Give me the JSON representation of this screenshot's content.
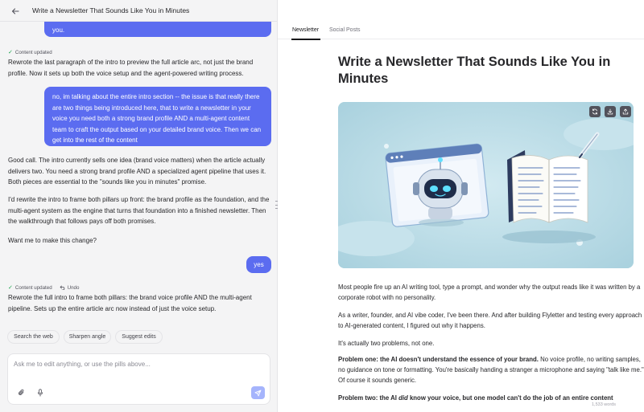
{
  "header": {
    "title": "Write a Newsletter That Sounds Like You in Minutes"
  },
  "chat": {
    "messages": [
      {
        "role": "user",
        "text": "you."
      },
      {
        "role": "status",
        "label": "Content updated"
      },
      {
        "role": "assistant",
        "text": "Rewrote the last paragraph of the intro to preview the full article arc, not just the brand profile. Now it sets up both the voice setup and the agent-powered writing process."
      },
      {
        "role": "user",
        "text": "no, im talking about the entire intro section -- the issue is that really there are two things being introduced here, that to write a newsletter in your voice you need both a strong brand profile AND a multi-agent content team to craft the output based on your detailed brand voice. Then we can get into the rest of the content"
      },
      {
        "role": "assistant",
        "paragraphs": [
          "Good call. The intro currently sells one idea (brand voice matters) when the article actually delivers two. You need a strong brand profile AND a specialized agent pipeline that uses it. Both pieces are essential to the \"sounds like you in minutes\" promise.",
          "I'd rewrite the intro to frame both pillars up front: the brand profile as the foundation, and the multi-agent system as the engine that turns that foundation into a finished newsletter. Then the walkthrough that follows pays off both promises.",
          "Want me to make this change?"
        ]
      },
      {
        "role": "user",
        "text": "yes"
      },
      {
        "role": "status",
        "label": "Content updated",
        "undo_label": "Undo"
      },
      {
        "role": "assistant",
        "text": "Rewrote the full intro to frame both pillars: the brand voice profile AND the multi-agent pipeline. Sets up the entire article arc now instead of just the voice setup."
      }
    ],
    "pills": [
      "Search the web",
      "Sharpen angle",
      "Suggest edits"
    ],
    "composer": {
      "placeholder": "Ask me to edit anything, or use the pills above..."
    }
  },
  "document": {
    "tabs": [
      "Newsletter",
      "Social Posts"
    ],
    "active_tab": "Newsletter",
    "title": "Write a Newsletter That Sounds Like You in Minutes",
    "hero_image": {
      "icons": [
        "refresh-icon",
        "download-icon",
        "share-icon"
      ]
    },
    "paragraphs": {
      "p1": "Most people fire up an AI writing tool, type a prompt, and wonder why the output reads like it was written by a corporate robot with no personality.",
      "p2": "As a writer, founder, and AI vibe coder, I've been there. And after building Flyletter and testing every approach to AI-generated content, I figured out why it happens.",
      "p3": "It's actually two problems, not one.",
      "p4_bold": "Problem one: the AI doesn't understand the essence of your brand.",
      "p4_rest": " No voice profile, no writing samples, no guidance on tone or formatting. You're basically handing a stranger a microphone and saying \"talk like me.\" Of course it sounds generic.",
      "p5_bold_a": "Problem two: the AI ",
      "p5_italic": "did",
      "p5_bold_b": " know your voice, but one model can't do the job of an entire content"
    },
    "word_count": "1,533 words"
  },
  "colors": {
    "user_bubble": "#5b6cf0",
    "status_check": "#16a34a",
    "send_button": "#a5b4fc",
    "hero_bg": "#b9dbe6"
  }
}
